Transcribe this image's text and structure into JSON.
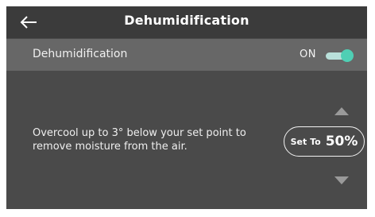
{
  "header": {
    "title": "Dehumidification",
    "back_icon": "left-arrow-icon"
  },
  "toggle_row": {
    "label": "Dehumidification",
    "state_text": "ON",
    "enabled": true,
    "accent_color": "#4fcfb4"
  },
  "description": "Overcool up to 3° below your set point to remove moisture from the air.",
  "setpoint": {
    "prefix": "Set To",
    "value": "50%",
    "increase_icon": "triangle-up-icon",
    "decrease_icon": "triangle-down-icon"
  }
}
